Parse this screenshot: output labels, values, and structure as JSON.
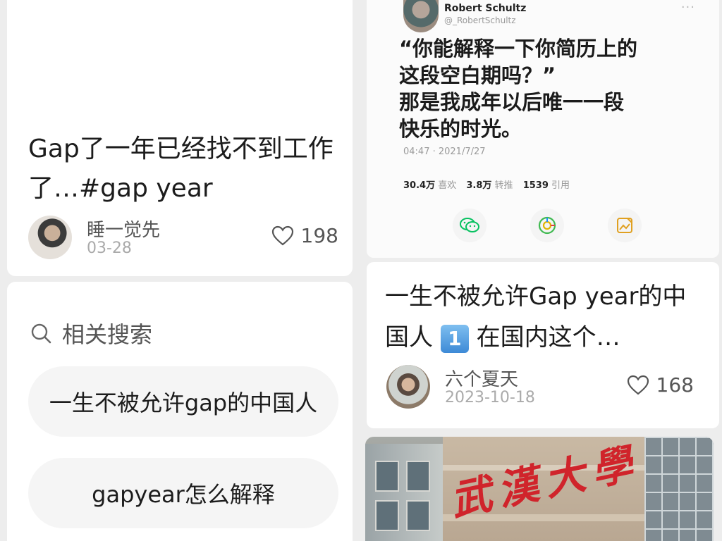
{
  "left_card": {
    "title": "Gap了一年已经找不到工作了…#gap year",
    "author": "睡一觉先",
    "date": "03-28",
    "likes": "198"
  },
  "related": {
    "label": "相关搜索",
    "items": [
      "一生不被允许gap的中国人",
      "gapyear怎么解释"
    ]
  },
  "tweet": {
    "name": "Robert Schultz",
    "handle": "@_RobertSchultz",
    "more": "···",
    "text": "“你能解释一下你简历上的\n这段空白期吗？”\n那是我成年以后唯一一段\n快乐的时光。",
    "time": "04:47 · 2021/7/27",
    "stats": [
      {
        "value": "30.4万",
        "label": "喜欢"
      },
      {
        "value": "3.8万",
        "label": "转推"
      },
      {
        "value": "1539",
        "label": "引用"
      }
    ],
    "share_icons": [
      "wechat-icon",
      "moments-icon",
      "poster-icon"
    ],
    "accent": "#07c160"
  },
  "right_post": {
    "title_part1": "一生不被允许Gap year的中国人",
    "badge": "1",
    "title_part2": "在国内这个…",
    "author": "六个夏天",
    "date": "2023-10-18",
    "likes": "168"
  },
  "photo": {
    "sign_text": "武漢大學"
  }
}
